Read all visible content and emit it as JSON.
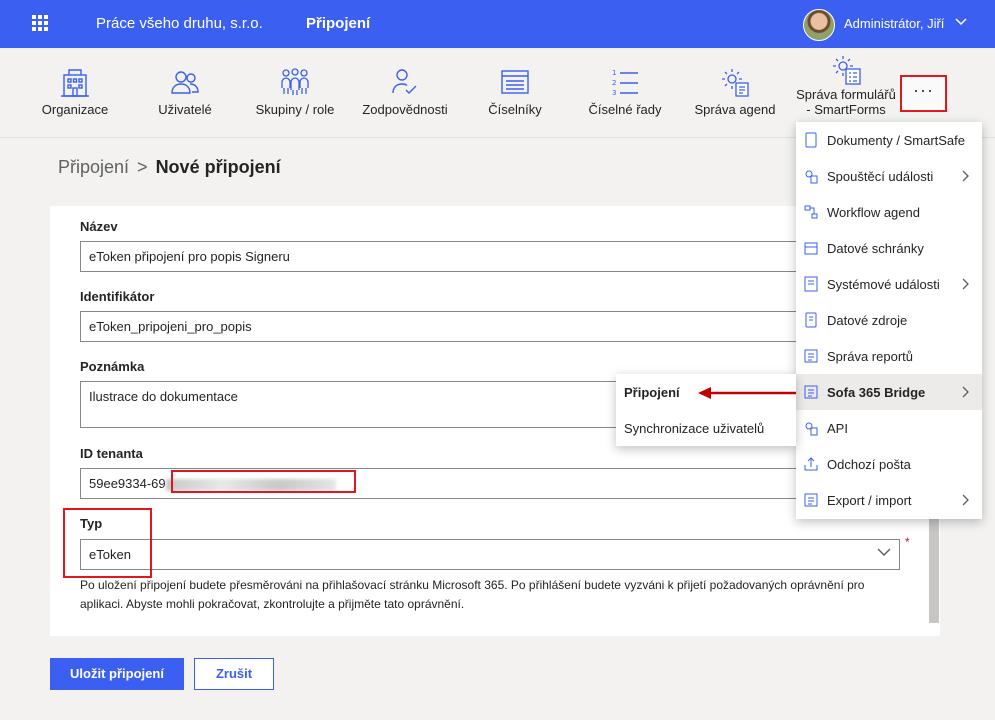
{
  "topbar": {
    "company": "Práce všeho druhu, s.r.o.",
    "section": "Připojení",
    "user": "Administrátor, Jiří"
  },
  "ribbon": {
    "items": [
      {
        "label": "Organizace",
        "icon": "building-icon"
      },
      {
        "label": "Uživatelé",
        "icon": "users-icon"
      },
      {
        "label": "Skupiny / role",
        "icon": "groups-icon"
      },
      {
        "label": "Zodpovědnosti",
        "icon": "user-check-icon"
      },
      {
        "label": "Číselníky",
        "icon": "list-window-icon"
      },
      {
        "label": "Číselné řady",
        "icon": "numbered-list-icon"
      },
      {
        "label": "Správa agend",
        "icon": "gear-doc-icon"
      },
      {
        "label": "Správa formulářů - SmartForms",
        "icon": "gear-form-icon"
      }
    ],
    "more": "···"
  },
  "breadcrumb": {
    "parent": "Připojení",
    "separator": ">",
    "current": "Nové připojení"
  },
  "form": {
    "name_label": "Název",
    "name_value": "eToken připojení pro popis Signeru",
    "id_label": "Identifikátor",
    "id_value": "eToken_pripojeni_pro_popis",
    "note_label": "Poznámka",
    "note_value": "Ilustrace do dokumentace",
    "tenant_label": "ID tenanta",
    "tenant_value": "59ee9334-69",
    "type_label": "Typ",
    "type_value": "eToken",
    "required_mark": "*",
    "help": "Po uložení připojení budete přesměrováni na přihlašovací stránku Microsoft 365. Po přihlášení budete vyzváni k přijetí požadovaných oprávnění pro aplikaci. Abyste mohli pokračovat, zkontrolujte a přijměte tato oprávnění."
  },
  "buttons": {
    "save": "Uložit připojení",
    "cancel": "Zrušit"
  },
  "menu": {
    "items": [
      {
        "label": "Dokumenty / SmartSafe",
        "submenu": false
      },
      {
        "label": "Spouštěcí události",
        "submenu": true
      },
      {
        "label": "Workflow agend",
        "submenu": false
      },
      {
        "label": "Datové schránky",
        "submenu": false
      },
      {
        "label": "Systémové události",
        "submenu": true
      },
      {
        "label": "Datové zdroje",
        "submenu": false
      },
      {
        "label": "Správa reportů",
        "submenu": false
      },
      {
        "label": "Sofa 365 Bridge",
        "submenu": true,
        "active": true
      },
      {
        "label": "API",
        "submenu": false
      },
      {
        "label": "Odchozí pošta",
        "submenu": false
      },
      {
        "label": "Export / import",
        "submenu": true
      }
    ]
  },
  "submenu": {
    "items": [
      "Připojení",
      "Synchronizace uživatelů"
    ]
  },
  "colors": {
    "primary": "#3b5ff0",
    "highlight": "#e0181d",
    "arrow": "#c00000"
  }
}
